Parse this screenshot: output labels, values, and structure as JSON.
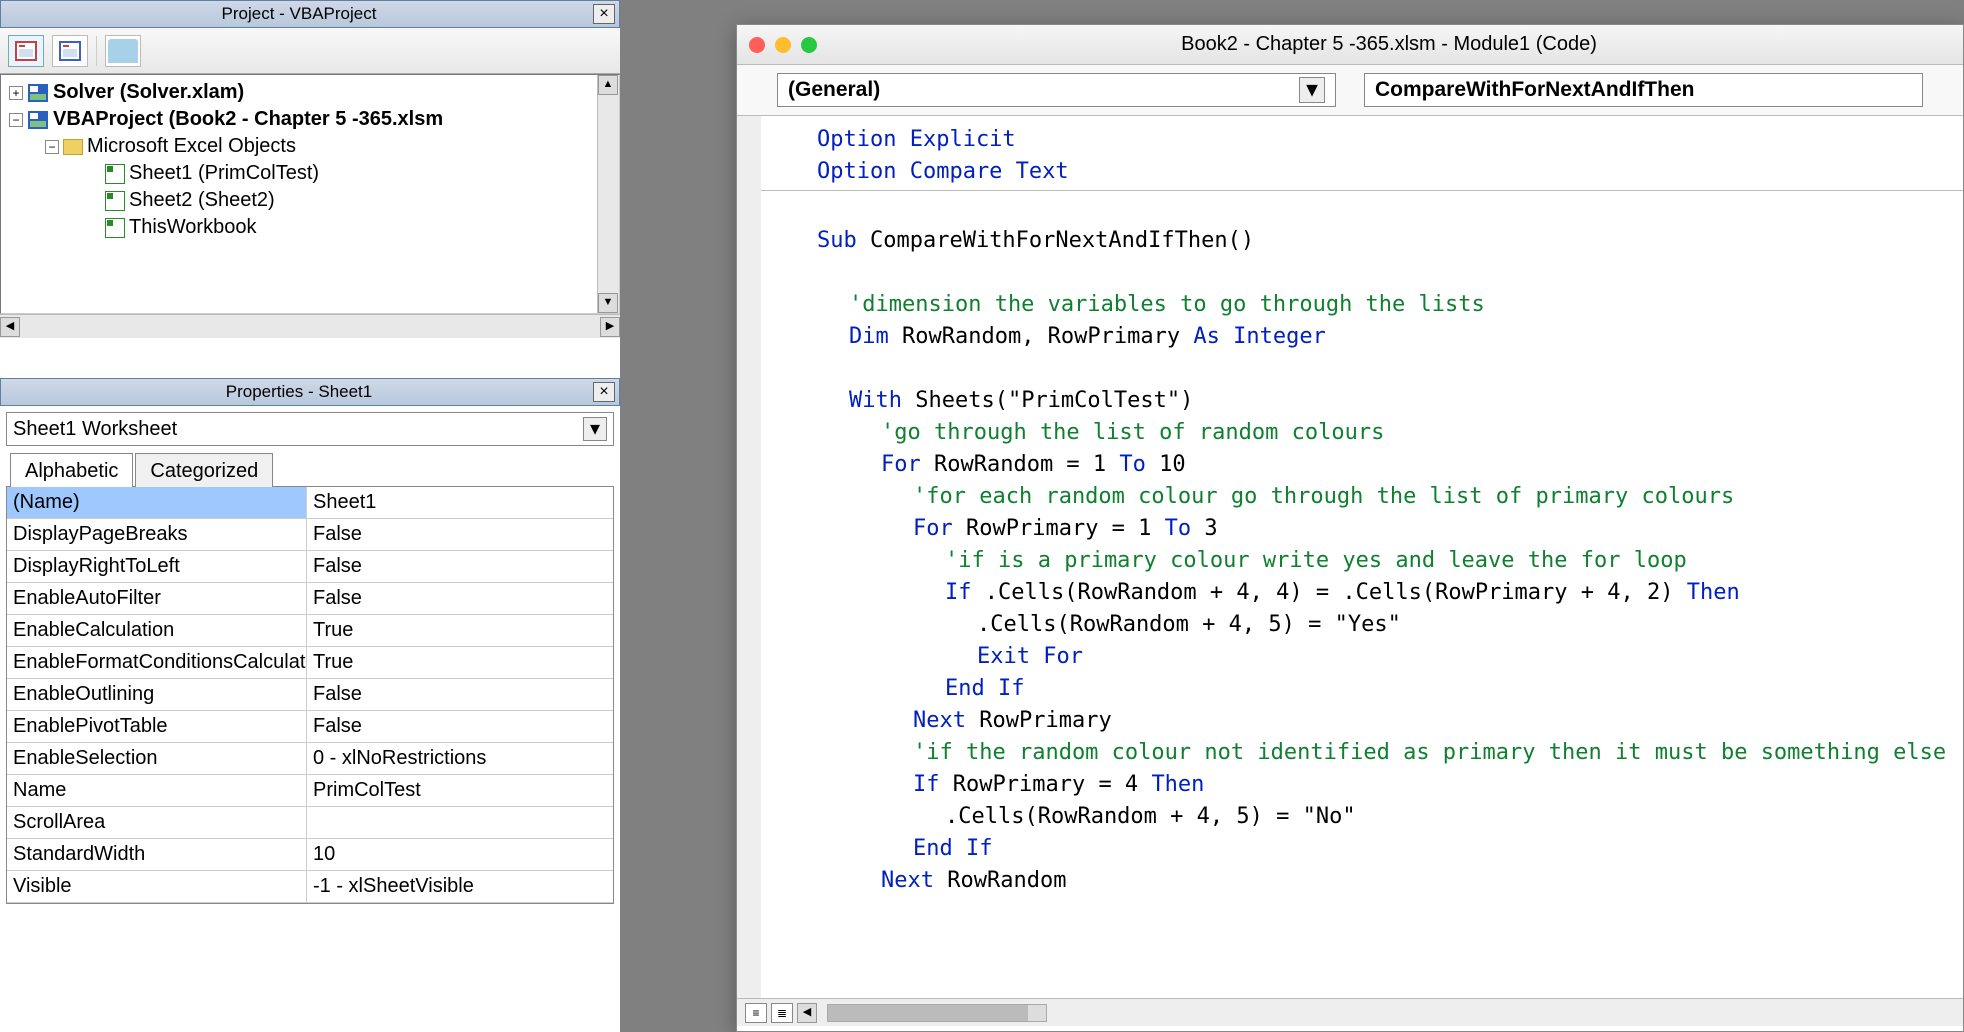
{
  "project_pane": {
    "title": "Project - VBAProject",
    "tree": {
      "solver": "Solver (Solver.xlam)",
      "vbaproject": "VBAProject (Book2 - Chapter 5 -365.xlsm",
      "objects_folder": "Microsoft Excel Objects",
      "sheet1": "Sheet1 (PrimColTest)",
      "sheet2": "Sheet2 (Sheet2)",
      "thiswb": "ThisWorkbook"
    }
  },
  "properties_pane": {
    "title": "Properties - Sheet1",
    "combo": "Sheet1 Worksheet",
    "tabs": {
      "alpha": "Alphabetic",
      "cat": "Categorized"
    },
    "rows": [
      {
        "k": "(Name)",
        "v": "Sheet1"
      },
      {
        "k": "DisplayPageBreaks",
        "v": "False"
      },
      {
        "k": "DisplayRightToLeft",
        "v": "False"
      },
      {
        "k": "EnableAutoFilter",
        "v": "False"
      },
      {
        "k": "EnableCalculation",
        "v": "True"
      },
      {
        "k": "EnableFormatConditionsCalculation",
        "v": "True"
      },
      {
        "k": "EnableOutlining",
        "v": "False"
      },
      {
        "k": "EnablePivotTable",
        "v": "False"
      },
      {
        "k": "EnableSelection",
        "v": "0 - xlNoRestrictions"
      },
      {
        "k": "Name",
        "v": "PrimColTest"
      },
      {
        "k": "ScrollArea",
        "v": ""
      },
      {
        "k": "StandardWidth",
        "v": "10"
      },
      {
        "k": "Visible",
        "v": "-1 - xlSheetVisible"
      }
    ]
  },
  "code_window": {
    "title": "Book2 - Chapter 5 -365.xlsm - Module1 (Code)",
    "combo_left": "(General)",
    "combo_right": "CompareWithForNextAndIfThen",
    "code": {
      "l1a": "Option Explicit",
      "l1b": "Option Compare Text",
      "l2_kw": "Sub ",
      "l2_tx": "CompareWithForNextAndIfThen()",
      "l3_cm": "'dimension the variables to go through the lists",
      "l4_kw1": "Dim ",
      "l4_tx": "RowRandom, RowPrimary ",
      "l4_kw2": "As Integer",
      "l5_kw": "With ",
      "l5_tx": "Sheets(\"PrimColTest\")",
      "l6_cm": "'go through the list of random colours",
      "l7_kw1": "For ",
      "l7_tx1": "RowRandom = 1 ",
      "l7_kw2": "To ",
      "l7_tx2": "10",
      "l8_cm": "'for each random colour go through the list of primary colours",
      "l9_kw1": "For ",
      "l9_tx1": "RowPrimary = 1 ",
      "l9_kw2": "To ",
      "l9_tx2": "3",
      "l10_cm": "'if is a primary colour write yes and leave the for loop",
      "l11_kw1": "If ",
      "l11_tx": ".Cells(RowRandom + 4, 4) = .Cells(RowPrimary + 4, 2) ",
      "l11_kw2": "Then",
      "l12_tx": ".Cells(RowRandom + 4, 5) = \"Yes\"",
      "l13_kw": "Exit For",
      "l14_kw": "End If",
      "l15_kw": "Next ",
      "l15_tx": "RowPrimary",
      "l16_cm": "'if the random colour not identified as primary then it must be something else",
      "l17_kw1": "If ",
      "l17_tx": "RowPrimary = 4 ",
      "l17_kw2": "Then",
      "l18_tx": ".Cells(RowRandom + 4, 5) = \"No\"",
      "l19_kw": "End If",
      "l20_kw": "Next ",
      "l20_tx": "RowRandom"
    }
  }
}
